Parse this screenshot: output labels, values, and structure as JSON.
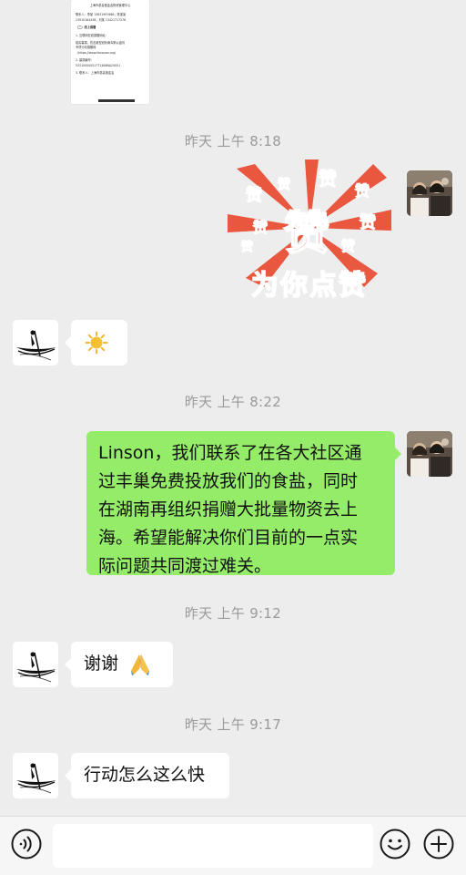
{
  "doc_preview": {
    "lines": [
      "上海市慈善基金会物资管理中心",
      "联系人：李某 13631997666；陈某某",
      "13910184438；刘某 13421717276",
      "（二）线上捐赠",
      "1. 互联网在线捐赠网址：",
      "慈善募捐，抗击新型冠状病毒肺炎疫情",
      "专项行动捐赠网",
      "（https://www.lianquan.org）",
      "2. 募捐编号：",
      "53310000051771468NA20001",
      "3. 联系人：上海市慈善基金会"
    ]
  },
  "messages": [
    {
      "type": "time",
      "text": "昨天 上午 8:18"
    },
    {
      "type": "sticker",
      "side": "right",
      "text": "为你点赞",
      "icon": "like-sticker"
    },
    {
      "type": "emoji",
      "side": "left",
      "icon": "sun-emoji"
    },
    {
      "type": "time",
      "text": "昨天 上午 8:22"
    },
    {
      "type": "text",
      "side": "right",
      "lines": [
        "Linson，我们联系了在各大社区通",
        "过丰巢免费投放我们的食盐，同时",
        "在湖南再组织捐赠大批量物资去上",
        "海。希望能解决你们目前的一点实",
        "际问题共同渡过难关。"
      ]
    },
    {
      "type": "time",
      "text": "昨天 上午 9:12"
    },
    {
      "type": "text",
      "side": "left",
      "text": "谢谢",
      "icon": "pray-emoji"
    },
    {
      "type": "time",
      "text": "昨天 上午 9:17"
    },
    {
      "type": "text",
      "side": "left",
      "text": "行动怎么这么快"
    }
  ],
  "sticker_text": "为你点赞",
  "sticker_word": "赞",
  "input_bar": {
    "voice_icon": "voice-icon",
    "emoji_icon": "emoji-icon",
    "plus_icon": "plus-icon",
    "input_value": ""
  },
  "colors": {
    "background": "#ededed",
    "my_bubble": "#95ec69",
    "their_bubble": "#ffffff",
    "timestamp": "#9a9a9a"
  }
}
